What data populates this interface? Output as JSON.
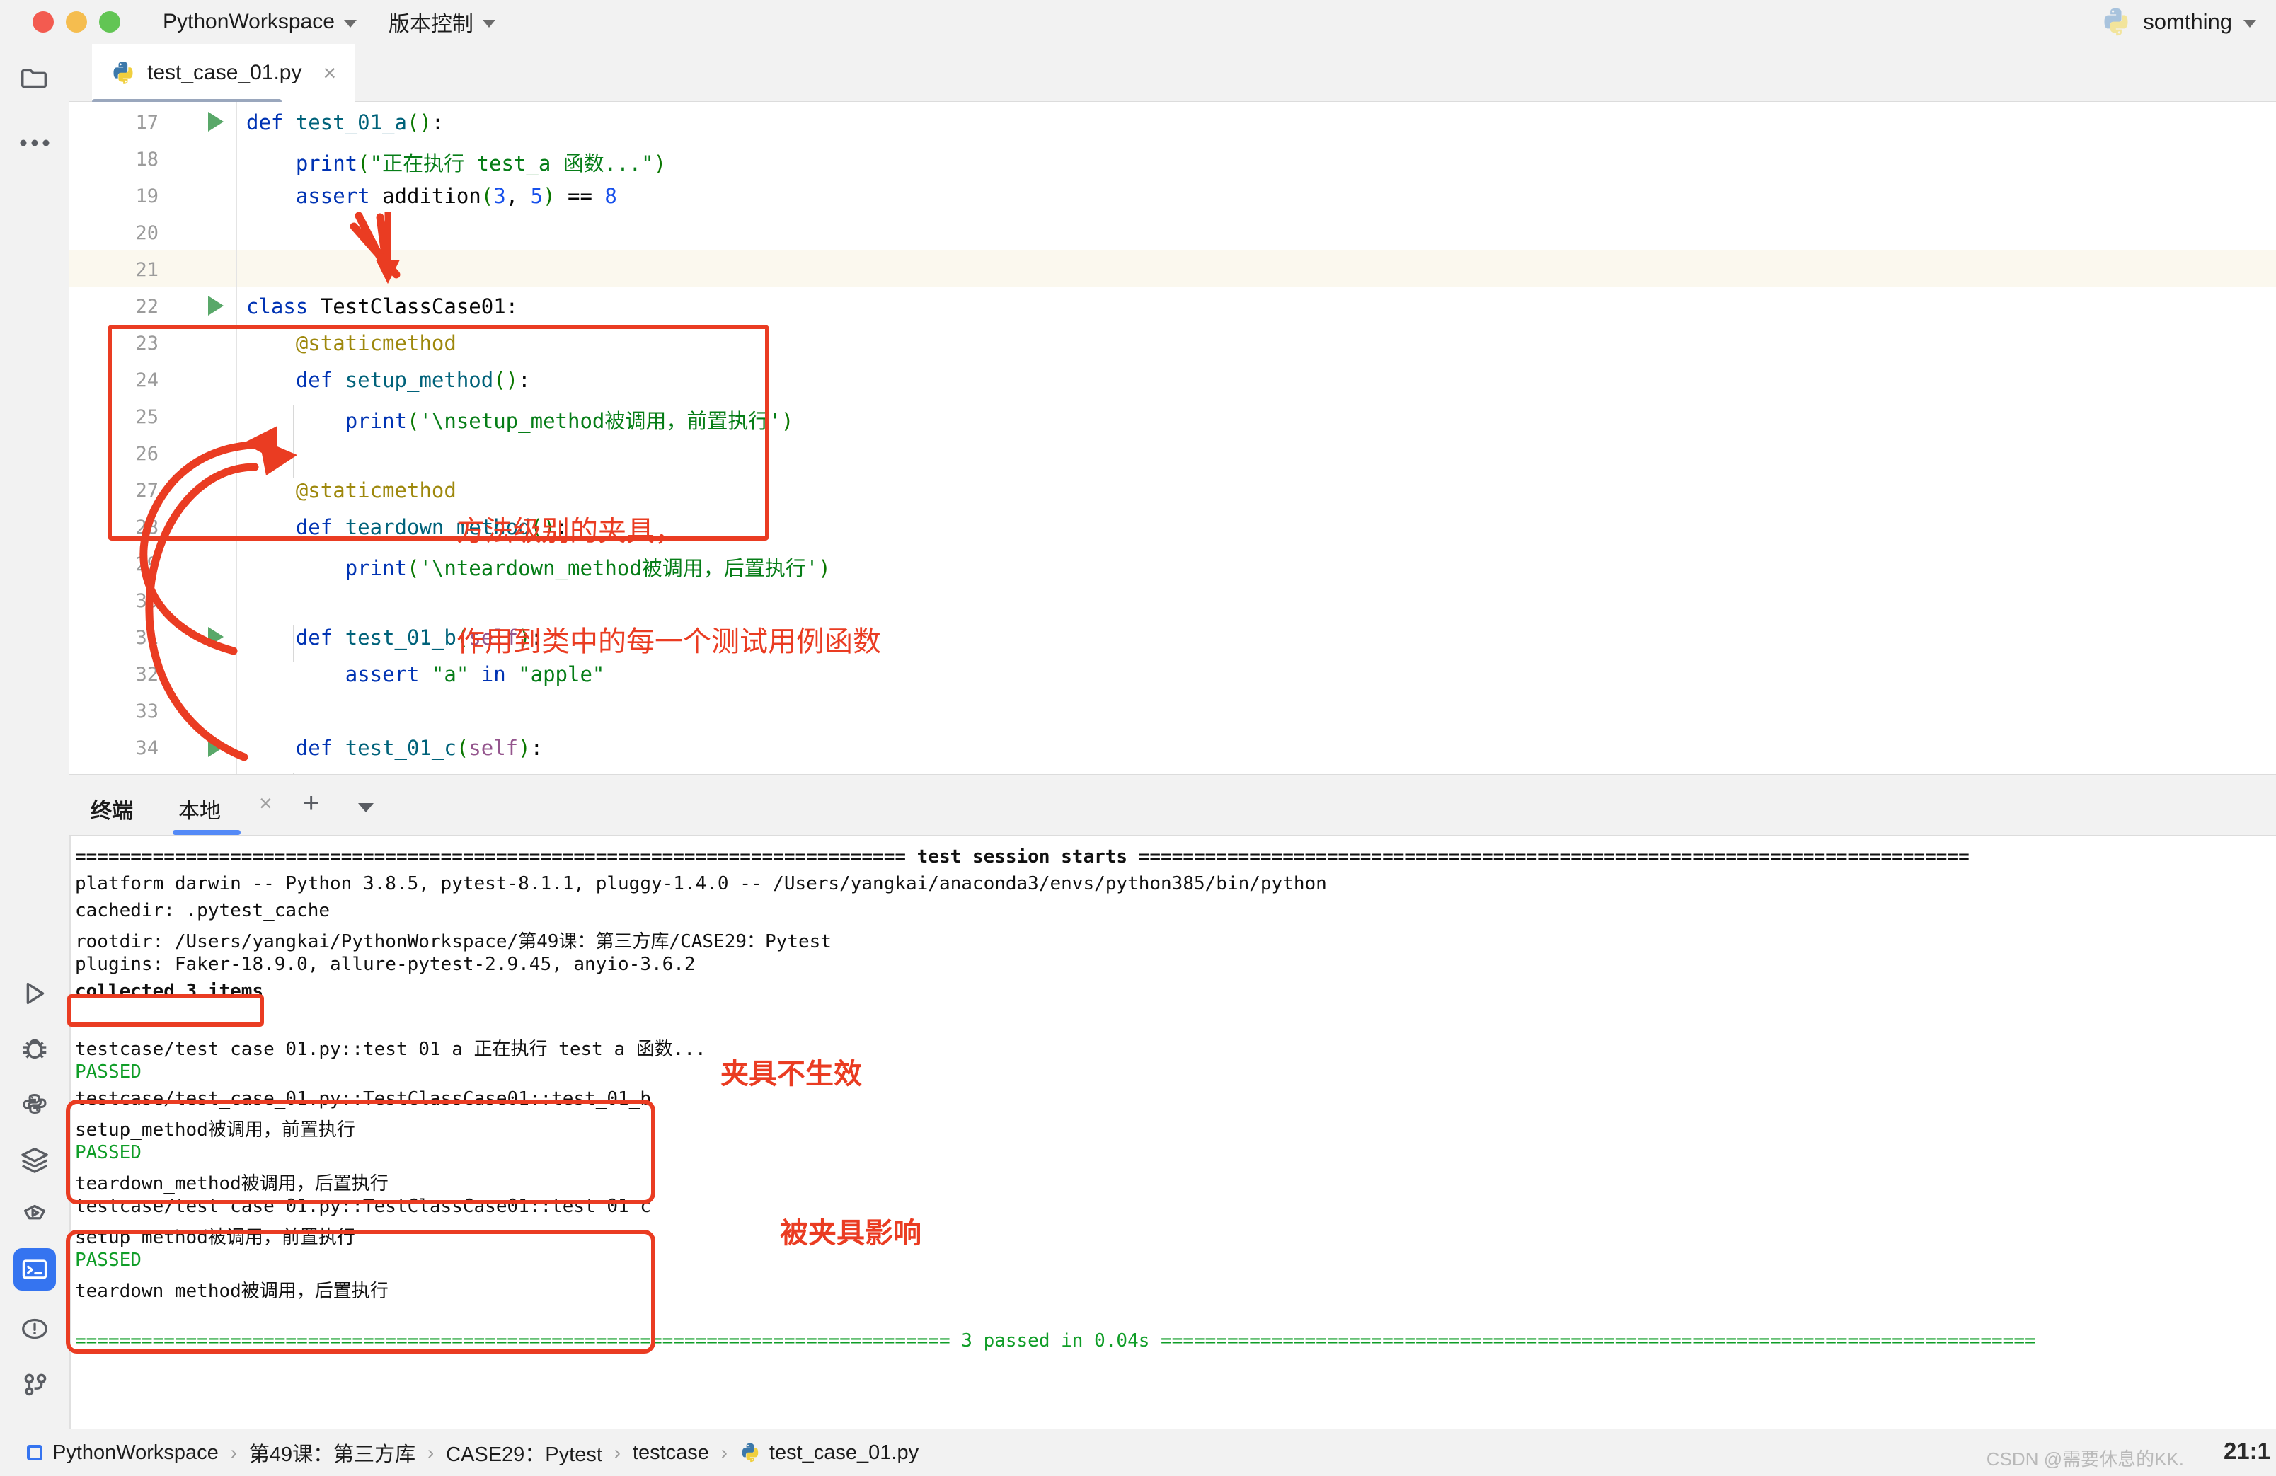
{
  "titlebar": {
    "project": "PythonWorkspace",
    "vcs": "版本控制",
    "user": "somthing"
  },
  "tab": {
    "filename": "test_case_01.py",
    "close": "×"
  },
  "rail": {
    "top_icons": [
      "folder-icon",
      "more-options-icon"
    ],
    "bottom_icons": [
      "run-icon",
      "debug-icon",
      "python-console-icon",
      "services-icon",
      "coverage-icon",
      "terminal-icon",
      "problems-icon",
      "version-control-icon"
    ]
  },
  "editor": {
    "lines": [
      {
        "no": "17",
        "run": true,
        "indent": 0,
        "highlight": false,
        "tokens": [
          {
            "t": "def ",
            "c": "kw"
          },
          {
            "t": "test_01_a",
            "c": "fn"
          },
          {
            "t": "()",
            "c": "pun"
          },
          {
            "t": ":",
            "c": "plain"
          }
        ]
      },
      {
        "no": "18",
        "run": false,
        "indent": 0,
        "highlight": false,
        "tokens": [
          {
            "t": "    ",
            "c": "plain"
          },
          {
            "t": "print",
            "c": "kw"
          },
          {
            "t": "(",
            "c": "pun"
          },
          {
            "t": "\"正在执行 test_a 函数...\"",
            "c": "str"
          },
          {
            "t": ")",
            "c": "pun"
          }
        ]
      },
      {
        "no": "19",
        "run": false,
        "indent": 0,
        "highlight": false,
        "tokens": [
          {
            "t": "    ",
            "c": "plain"
          },
          {
            "t": "assert",
            "c": "kw"
          },
          {
            "t": " addition",
            "c": "plain"
          },
          {
            "t": "(",
            "c": "pun"
          },
          {
            "t": "3",
            "c": "num"
          },
          {
            "t": ", ",
            "c": "plain"
          },
          {
            "t": "5",
            "c": "num"
          },
          {
            "t": ")",
            "c": "pun"
          },
          {
            "t": " == ",
            "c": "plain"
          },
          {
            "t": "8",
            "c": "num"
          }
        ]
      },
      {
        "no": "20",
        "run": false,
        "indent": 0,
        "highlight": false,
        "tokens": []
      },
      {
        "no": "21",
        "run": false,
        "indent": 0,
        "highlight": true,
        "tokens": []
      },
      {
        "no": "22",
        "run": true,
        "indent": 0,
        "highlight": false,
        "tokens": [
          {
            "t": "class ",
            "c": "kw"
          },
          {
            "t": "TestClassCase01",
            "c": "plain"
          },
          {
            "t": ":",
            "c": "plain"
          }
        ]
      },
      {
        "no": "23",
        "run": false,
        "indent": 0,
        "highlight": false,
        "tokens": [
          {
            "t": "    ",
            "c": "plain"
          },
          {
            "t": "@staticmethod",
            "c": "dec"
          }
        ]
      },
      {
        "no": "24",
        "run": false,
        "indent": 0,
        "highlight": false,
        "tokens": [
          {
            "t": "    ",
            "c": "plain"
          },
          {
            "t": "def ",
            "c": "kw"
          },
          {
            "t": "setup_method",
            "c": "fn"
          },
          {
            "t": "()",
            "c": "pun"
          },
          {
            "t": ":",
            "c": "plain"
          }
        ]
      },
      {
        "no": "25",
        "run": false,
        "indent": 0,
        "highlight": false,
        "tokens": [
          {
            "t": "        ",
            "c": "plain"
          },
          {
            "t": "print",
            "c": "kw"
          },
          {
            "t": "(",
            "c": "pun"
          },
          {
            "t": "'\\nsetup_method被调用，前置执行'",
            "c": "str"
          },
          {
            "t": ")",
            "c": "pun"
          }
        ]
      },
      {
        "no": "26",
        "run": false,
        "indent": 0,
        "highlight": false,
        "tokens": []
      },
      {
        "no": "27",
        "run": false,
        "indent": 0,
        "highlight": false,
        "tokens": [
          {
            "t": "    ",
            "c": "plain"
          },
          {
            "t": "@staticmethod",
            "c": "dec"
          }
        ]
      },
      {
        "no": "28",
        "run": false,
        "indent": 0,
        "highlight": false,
        "tokens": [
          {
            "t": "    ",
            "c": "plain"
          },
          {
            "t": "def ",
            "c": "kw"
          },
          {
            "t": "teardown_method",
            "c": "fn"
          },
          {
            "t": "()",
            "c": "pun"
          },
          {
            "t": ":",
            "c": "plain"
          }
        ]
      },
      {
        "no": "29",
        "run": false,
        "indent": 0,
        "highlight": false,
        "tokens": [
          {
            "t": "        ",
            "c": "plain"
          },
          {
            "t": "print",
            "c": "kw"
          },
          {
            "t": "(",
            "c": "pun"
          },
          {
            "t": "'\\nteardown_method被调用，后置执行'",
            "c": "str"
          },
          {
            "t": ")",
            "c": "pun"
          }
        ]
      },
      {
        "no": "30",
        "run": false,
        "indent": 0,
        "highlight": false,
        "tokens": []
      },
      {
        "no": "31",
        "run": true,
        "indent": 0,
        "highlight": false,
        "tokens": [
          {
            "t": "    ",
            "c": "plain"
          },
          {
            "t": "def ",
            "c": "kw"
          },
          {
            "t": "test_01_b",
            "c": "fn"
          },
          {
            "t": "(",
            "c": "pun"
          },
          {
            "t": "self",
            "c": "slf"
          },
          {
            "t": ")",
            "c": "pun"
          },
          {
            "t": ":",
            "c": "plain"
          }
        ]
      },
      {
        "no": "32",
        "run": false,
        "indent": 0,
        "highlight": false,
        "tokens": [
          {
            "t": "        ",
            "c": "plain"
          },
          {
            "t": "assert",
            "c": "kw"
          },
          {
            "t": " ",
            "c": "plain"
          },
          {
            "t": "\"a\"",
            "c": "str"
          },
          {
            "t": " in ",
            "c": "kw"
          },
          {
            "t": "\"apple\"",
            "c": "str"
          }
        ]
      },
      {
        "no": "33",
        "run": false,
        "indent": 0,
        "highlight": false,
        "tokens": []
      },
      {
        "no": "34",
        "run": true,
        "indent": 0,
        "highlight": false,
        "tokens": [
          {
            "t": "    ",
            "c": "plain"
          },
          {
            "t": "def ",
            "c": "kw"
          },
          {
            "t": "test_01_c",
            "c": "fn"
          },
          {
            "t": "(",
            "c": "pun"
          },
          {
            "t": "self",
            "c": "slf"
          },
          {
            "t": ")",
            "c": "pun"
          },
          {
            "t": ":",
            "c": "plain"
          }
        ]
      }
    ]
  },
  "annotations": {
    "accent_color": "#ea3c22",
    "code_note_line1": "方法级别的夹具，",
    "code_note_line2": "作用到类中的每一个测试用例函数",
    "term_note_1": "夹具不生效",
    "term_note_2": "被夹具影响"
  },
  "terminal": {
    "tab_title": "终端",
    "local_tab": "本地",
    "close": "×",
    "add": "+",
    "lines": [
      {
        "text": "=========================================================================== test session starts ===========================================================================",
        "style": "bold"
      },
      {
        "text": "platform darwin -- Python 3.8.5, pytest-8.1.1, pluggy-1.4.0 -- /Users/yangkai/anaconda3/envs/python385/bin/python",
        "style": "plain"
      },
      {
        "text": "cachedir: .pytest_cache",
        "style": "plain"
      },
      {
        "text": "rootdir: /Users/yangkai/PythonWorkspace/第49课：第三方库/CASE29：Pytest",
        "style": "plain"
      },
      {
        "text": "plugins: Faker-18.9.0, allure-pytest-2.9.45, anyio-3.6.2",
        "style": "plain"
      },
      {
        "text": "collected 3 items",
        "style": "bold"
      },
      {
        "text": "",
        "style": "plain"
      },
      {
        "text": "testcase/test_case_01.py::test_01_a 正在执行 test_a 函数...",
        "style": "plain"
      },
      {
        "text": "PASSED",
        "style": "green"
      },
      {
        "text": "testcase/test_case_01.py::TestClassCase01::test_01_b",
        "style": "plain"
      },
      {
        "text": "setup_method被调用，前置执行",
        "style": "plain"
      },
      {
        "text": "PASSED",
        "style": "green"
      },
      {
        "text": "teardown_method被调用，后置执行",
        "style": "plain"
      },
      {
        "text": "testcase/test_case_01.py::TestClassCase01::test_01_c",
        "style": "plain"
      },
      {
        "text": "setup_method被调用，前置执行",
        "style": "plain"
      },
      {
        "text": "PASSED",
        "style": "green"
      },
      {
        "text": "teardown_method被调用，后置执行",
        "style": "plain"
      },
      {
        "text": "",
        "style": "plain"
      },
      {
        "text": "=============================================================================== 3 passed in 0.04s ===============================================================================",
        "style": "green"
      }
    ]
  },
  "statusbar": {
    "breadcrumb": [
      "PythonWorkspace",
      "第49课：第三方库",
      "CASE29：Pytest",
      "testcase",
      "test_case_01.py"
    ],
    "separator": "›",
    "watermark": "CSDN @需要休息的KK.",
    "clock": "21:1"
  }
}
